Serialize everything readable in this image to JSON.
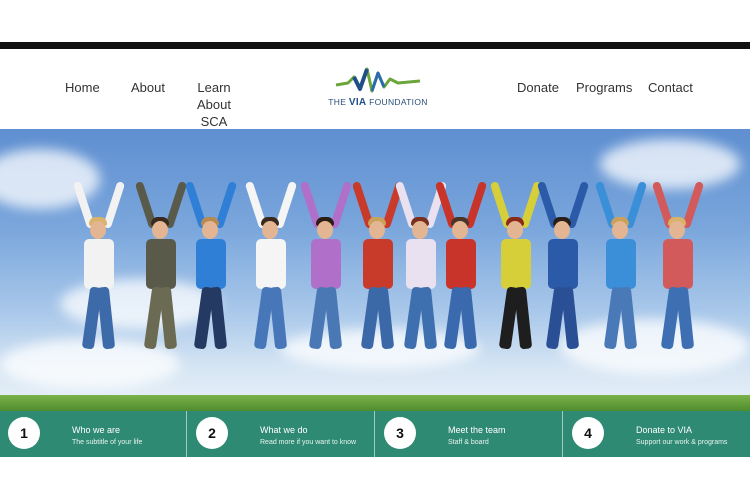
{
  "nav": {
    "home": "Home",
    "about": "About",
    "learn_line1": "Learn",
    "learn_line2": "About SCA",
    "donate": "Donate",
    "programs": "Programs",
    "contact": "Contact"
  },
  "logo": {
    "prefix": "THE",
    "name": "VIA",
    "suffix": "FOUNDATION"
  },
  "hero": {
    "icon": "group-jumping-photo"
  },
  "features": [
    {
      "number": "1",
      "title": "Who we are",
      "subtitle": "The subtitle of your life"
    },
    {
      "number": "2",
      "title": "What we do",
      "subtitle": "Read more if you want to know"
    },
    {
      "number": "3",
      "title": "Meet the team",
      "subtitle": "Staff & board"
    },
    {
      "number": "4",
      "title": "Donate to VIA",
      "subtitle": "Support our work & programs"
    }
  ],
  "colors": {
    "feature_bar": "#2f8a74",
    "logo_blue": "#1f4f86",
    "logo_green": "#6aa63b"
  }
}
